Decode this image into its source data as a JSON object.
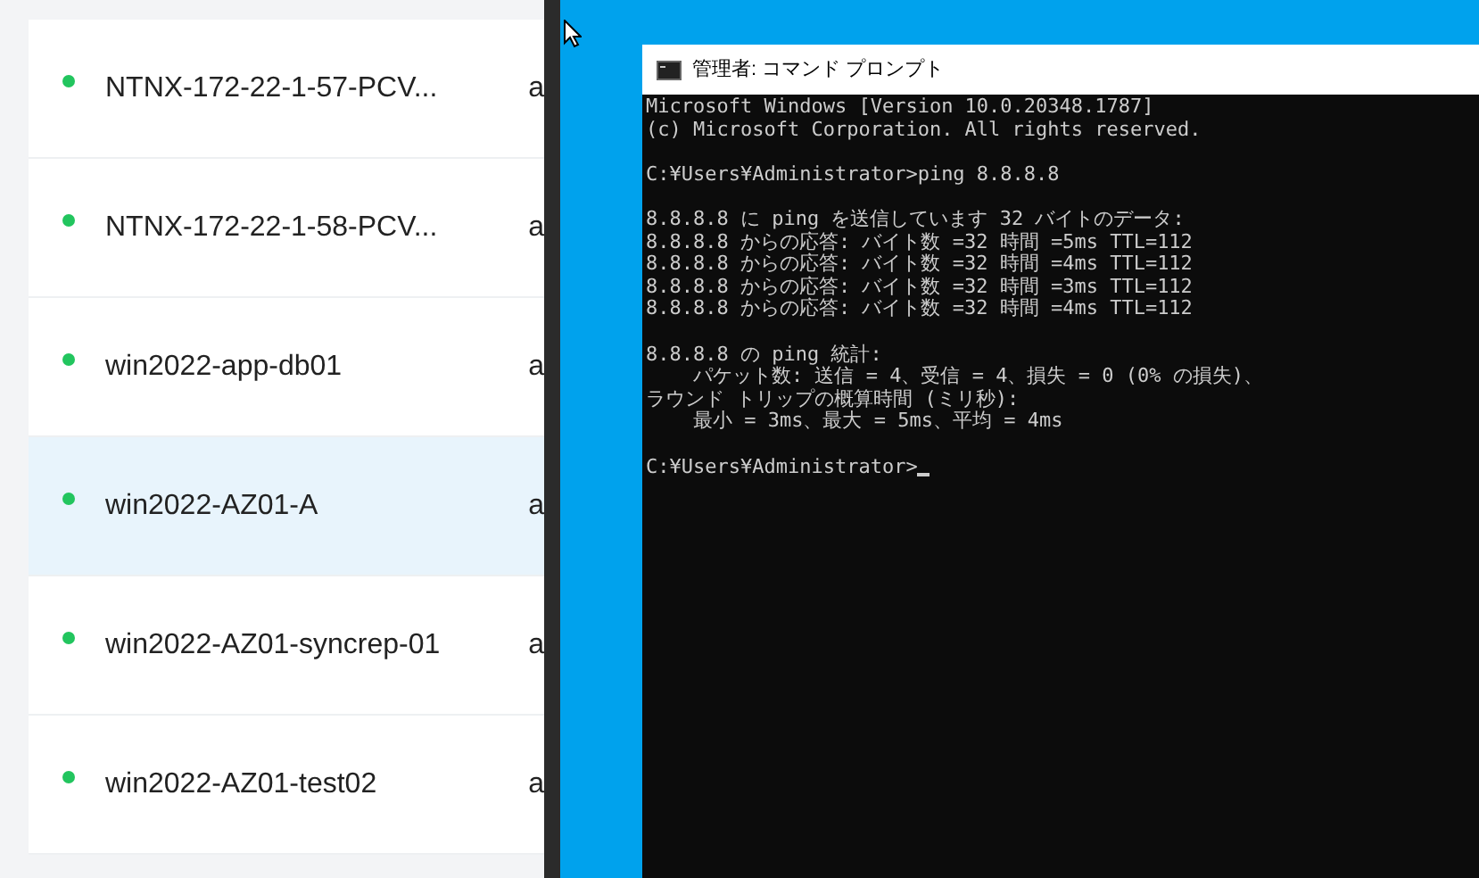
{
  "vm_list": {
    "rows": [
      {
        "name": "NTNX-172-22-1-57-PCV...",
        "column_2": "a",
        "color": "#22c55e",
        "selected": false
      },
      {
        "name": "NTNX-172-22-1-58-PCV...",
        "column_2": "a",
        "color": "#22c55e",
        "selected": false
      },
      {
        "name": "win2022-app-db01",
        "column_2": "a",
        "color": "#22c55e",
        "selected": false
      },
      {
        "name": "win2022-AZ01-A",
        "column_2": "a",
        "color": "#22c55e",
        "selected": true
      },
      {
        "name": "win2022-AZ01-syncrep-01",
        "column_2": "a",
        "color": "#22c55e",
        "selected": false
      },
      {
        "name": "win2022-AZ01-test02",
        "column_2": "a",
        "color": "#22c55e",
        "selected": false
      }
    ]
  },
  "console_window": {
    "title": "管理者: コマンド プロンプト",
    "lines": [
      {
        "text": "Microsoft Windows [Version 10.0.20348.1787]",
        "blank_before": false
      },
      {
        "text": "(c) Microsoft Corporation. All rights reserved.",
        "blank_before": false
      },
      {
        "text": "C:¥Users¥Administrator>ping 8.8.8.8",
        "blank_before": true
      },
      {
        "text": "8.8.8.8 に ping を送信しています 32 バイトのデータ:",
        "blank_before": true
      },
      {
        "text": "8.8.8.8 からの応答: バイト数 =32 時間 =5ms TTL=112",
        "blank_before": false
      },
      {
        "text": "8.8.8.8 からの応答: バイト数 =32 時間 =4ms TTL=112",
        "blank_before": false
      },
      {
        "text": "8.8.8.8 からの応答: バイト数 =32 時間 =3ms TTL=112",
        "blank_before": false
      },
      {
        "text": "8.8.8.8 からの応答: バイト数 =32 時間 =4ms TTL=112",
        "blank_before": false
      },
      {
        "text": "8.8.8.8 の ping 統計:",
        "blank_before": true
      },
      {
        "text": "    パケット数: 送信 = 4、受信 = 4、損失 = 0 (0% の損失)、",
        "blank_before": false
      },
      {
        "text": "ラウンド トリップの概算時間 (ミリ秒):",
        "blank_before": false
      },
      {
        "text": "    最小 = 3ms、最大 = 5ms、平均 = 4ms",
        "blank_before": false
      },
      {
        "text": "C:¥Users¥Administrator>",
        "blank_before": true,
        "cursor": true
      }
    ]
  }
}
